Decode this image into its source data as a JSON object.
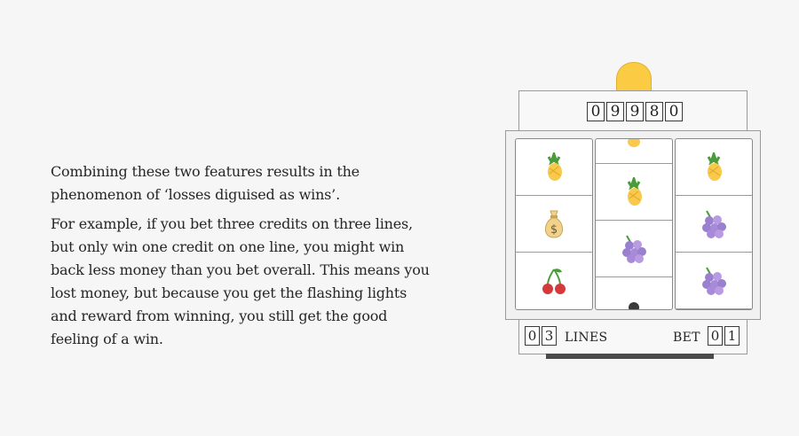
{
  "article": {
    "paragraphs": [
      "Combining these two features results in the phenomenon of ‘losses diguised as wins’.",
      "For example, if you bet three credits on three lines, but only win one credit on one line, you might win back less money than you bet overall. This means you lost money, but because you get the flashing lights and reward from winning, you still get the good feeling of a win."
    ]
  },
  "slot_machine": {
    "credits_digits": [
      "0",
      "9",
      "9",
      "8",
      "0"
    ],
    "lines_digits": [
      "0",
      "3"
    ],
    "lines_label": "LINES",
    "bet_label": "BET",
    "bet_digits": [
      "0",
      "1"
    ],
    "reels": [
      [
        "pineapple-icon",
        "money-bag-icon",
        "cherries-icon"
      ],
      [
        "pineapple-icon",
        "pineapple-icon",
        "grapes-icon",
        "person-icon"
      ],
      [
        "pineapple-icon",
        "grapes-icon",
        "grapes-icon"
      ]
    ],
    "colors": {
      "light": "#fccb44",
      "pineapple": "#f8c94a",
      "grapes": "#9b7fd0",
      "cherry": "#d53a3a",
      "moneybag": "#f2d28a"
    }
  }
}
